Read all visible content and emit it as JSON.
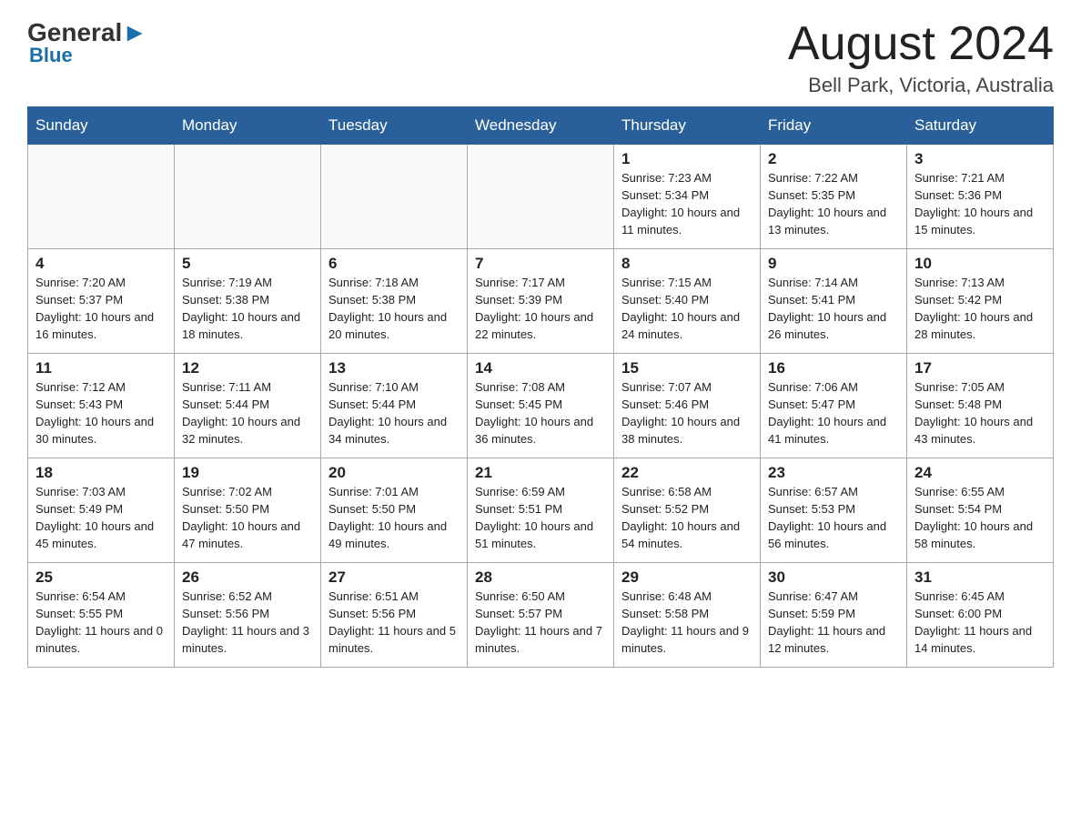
{
  "header": {
    "logo_general": "General",
    "logo_blue": "Blue",
    "month_title": "August 2024",
    "location": "Bell Park, Victoria, Australia"
  },
  "days_of_week": [
    "Sunday",
    "Monday",
    "Tuesday",
    "Wednesday",
    "Thursday",
    "Friday",
    "Saturday"
  ],
  "weeks": [
    [
      {
        "day": "",
        "info": ""
      },
      {
        "day": "",
        "info": ""
      },
      {
        "day": "",
        "info": ""
      },
      {
        "day": "",
        "info": ""
      },
      {
        "day": "1",
        "info": "Sunrise: 7:23 AM\nSunset: 5:34 PM\nDaylight: 10 hours and 11 minutes."
      },
      {
        "day": "2",
        "info": "Sunrise: 7:22 AM\nSunset: 5:35 PM\nDaylight: 10 hours and 13 minutes."
      },
      {
        "day": "3",
        "info": "Sunrise: 7:21 AM\nSunset: 5:36 PM\nDaylight: 10 hours and 15 minutes."
      }
    ],
    [
      {
        "day": "4",
        "info": "Sunrise: 7:20 AM\nSunset: 5:37 PM\nDaylight: 10 hours and 16 minutes."
      },
      {
        "day": "5",
        "info": "Sunrise: 7:19 AM\nSunset: 5:38 PM\nDaylight: 10 hours and 18 minutes."
      },
      {
        "day": "6",
        "info": "Sunrise: 7:18 AM\nSunset: 5:38 PM\nDaylight: 10 hours and 20 minutes."
      },
      {
        "day": "7",
        "info": "Sunrise: 7:17 AM\nSunset: 5:39 PM\nDaylight: 10 hours and 22 minutes."
      },
      {
        "day": "8",
        "info": "Sunrise: 7:15 AM\nSunset: 5:40 PM\nDaylight: 10 hours and 24 minutes."
      },
      {
        "day": "9",
        "info": "Sunrise: 7:14 AM\nSunset: 5:41 PM\nDaylight: 10 hours and 26 minutes."
      },
      {
        "day": "10",
        "info": "Sunrise: 7:13 AM\nSunset: 5:42 PM\nDaylight: 10 hours and 28 minutes."
      }
    ],
    [
      {
        "day": "11",
        "info": "Sunrise: 7:12 AM\nSunset: 5:43 PM\nDaylight: 10 hours and 30 minutes."
      },
      {
        "day": "12",
        "info": "Sunrise: 7:11 AM\nSunset: 5:44 PM\nDaylight: 10 hours and 32 minutes."
      },
      {
        "day": "13",
        "info": "Sunrise: 7:10 AM\nSunset: 5:44 PM\nDaylight: 10 hours and 34 minutes."
      },
      {
        "day": "14",
        "info": "Sunrise: 7:08 AM\nSunset: 5:45 PM\nDaylight: 10 hours and 36 minutes."
      },
      {
        "day": "15",
        "info": "Sunrise: 7:07 AM\nSunset: 5:46 PM\nDaylight: 10 hours and 38 minutes."
      },
      {
        "day": "16",
        "info": "Sunrise: 7:06 AM\nSunset: 5:47 PM\nDaylight: 10 hours and 41 minutes."
      },
      {
        "day": "17",
        "info": "Sunrise: 7:05 AM\nSunset: 5:48 PM\nDaylight: 10 hours and 43 minutes."
      }
    ],
    [
      {
        "day": "18",
        "info": "Sunrise: 7:03 AM\nSunset: 5:49 PM\nDaylight: 10 hours and 45 minutes."
      },
      {
        "day": "19",
        "info": "Sunrise: 7:02 AM\nSunset: 5:50 PM\nDaylight: 10 hours and 47 minutes."
      },
      {
        "day": "20",
        "info": "Sunrise: 7:01 AM\nSunset: 5:50 PM\nDaylight: 10 hours and 49 minutes."
      },
      {
        "day": "21",
        "info": "Sunrise: 6:59 AM\nSunset: 5:51 PM\nDaylight: 10 hours and 51 minutes."
      },
      {
        "day": "22",
        "info": "Sunrise: 6:58 AM\nSunset: 5:52 PM\nDaylight: 10 hours and 54 minutes."
      },
      {
        "day": "23",
        "info": "Sunrise: 6:57 AM\nSunset: 5:53 PM\nDaylight: 10 hours and 56 minutes."
      },
      {
        "day": "24",
        "info": "Sunrise: 6:55 AM\nSunset: 5:54 PM\nDaylight: 10 hours and 58 minutes."
      }
    ],
    [
      {
        "day": "25",
        "info": "Sunrise: 6:54 AM\nSunset: 5:55 PM\nDaylight: 11 hours and 0 minutes."
      },
      {
        "day": "26",
        "info": "Sunrise: 6:52 AM\nSunset: 5:56 PM\nDaylight: 11 hours and 3 minutes."
      },
      {
        "day": "27",
        "info": "Sunrise: 6:51 AM\nSunset: 5:56 PM\nDaylight: 11 hours and 5 minutes."
      },
      {
        "day": "28",
        "info": "Sunrise: 6:50 AM\nSunset: 5:57 PM\nDaylight: 11 hours and 7 minutes."
      },
      {
        "day": "29",
        "info": "Sunrise: 6:48 AM\nSunset: 5:58 PM\nDaylight: 11 hours and 9 minutes."
      },
      {
        "day": "30",
        "info": "Sunrise: 6:47 AM\nSunset: 5:59 PM\nDaylight: 11 hours and 12 minutes."
      },
      {
        "day": "31",
        "info": "Sunrise: 6:45 AM\nSunset: 6:00 PM\nDaylight: 11 hours and 14 minutes."
      }
    ]
  ]
}
